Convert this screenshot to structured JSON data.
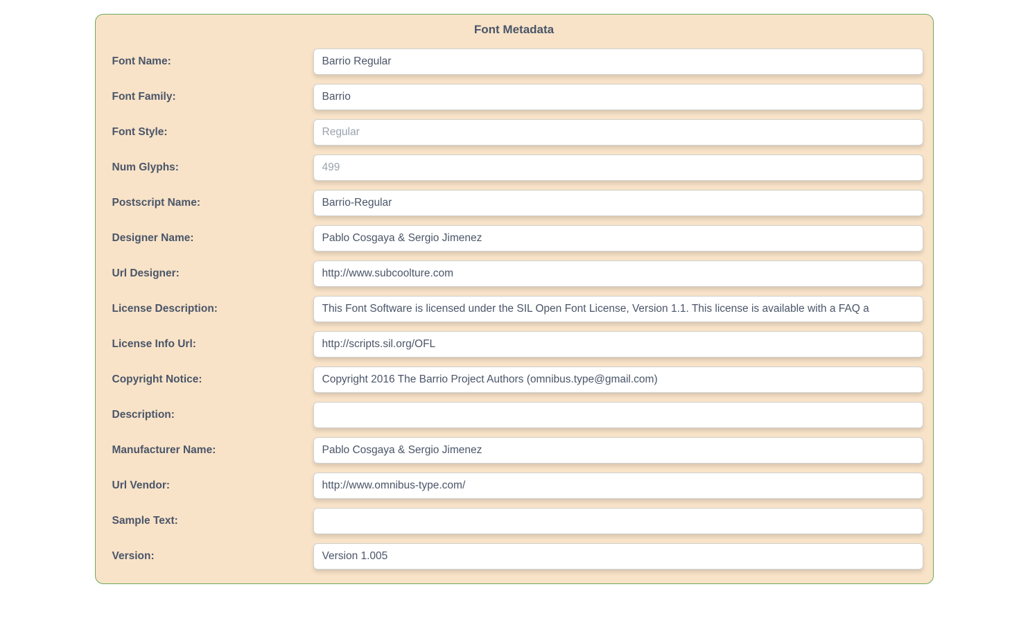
{
  "panel": {
    "title": "Font Metadata",
    "labels": {
      "font_name": "Font Name:",
      "font_family": "Font Family:",
      "font_style": "Font Style:",
      "num_glyphs": "Num Glyphs:",
      "postscript_name": "Postscript Name:",
      "designer_name": "Designer Name:",
      "url_designer": "Url Designer:",
      "license_description": "License Description:",
      "license_info_url": "License Info Url:",
      "copyright_notice": "Copyright Notice:",
      "description": "Description:",
      "manufacturer_name": "Manufacturer Name:",
      "url_vendor": "Url Vendor:",
      "sample_text": "Sample Text:",
      "version": "Version:"
    },
    "values": {
      "font_name": "Barrio Regular",
      "font_family": "Barrio",
      "font_style": "Regular",
      "num_glyphs": "499",
      "postscript_name": "Barrio-Regular",
      "designer_name": "Pablo Cosgaya & Sergio Jimenez",
      "url_designer": "http://www.subcoolture.com",
      "license_description": "This Font Software is licensed under the SIL Open Font License, Version 1.1. This license is available with a FAQ a",
      "license_info_url": "http://scripts.sil.org/OFL",
      "copyright_notice": "Copyright 2016 The Barrio Project Authors (omnibus.type@gmail.com)",
      "description": "",
      "manufacturer_name": "Pablo Cosgaya & Sergio Jimenez",
      "url_vendor": "http://www.omnibus-type.com/",
      "sample_text": "",
      "version": "Version 1.005"
    }
  }
}
